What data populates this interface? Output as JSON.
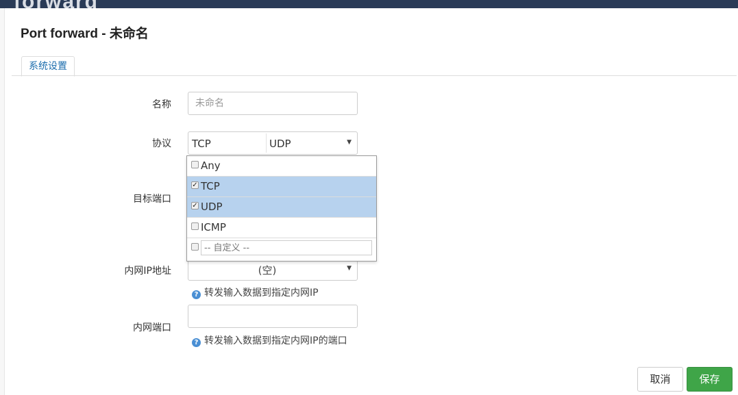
{
  "background": {
    "peek_text": "forward"
  },
  "dialog": {
    "title": "Port forward - 未命名",
    "tabs": [
      {
        "label": "系统设置",
        "active": true
      }
    ]
  },
  "form": {
    "name": {
      "label": "名称",
      "value": "",
      "placeholder": "未命名"
    },
    "protocol": {
      "label": "协议",
      "selected_values": [
        "TCP",
        "UDP"
      ],
      "options": [
        {
          "label": "Any",
          "checked": false
        },
        {
          "label": "TCP",
          "checked": true
        },
        {
          "label": "UDP",
          "checked": true
        },
        {
          "label": "ICMP",
          "checked": false
        }
      ],
      "custom_placeholder": "-- 自定义 --"
    },
    "target_port": {
      "label": "目标端口"
    },
    "lan_ip": {
      "label": "内网IP地址",
      "value": "(空)",
      "help": "转发输入数据到指定内网IP"
    },
    "lan_port": {
      "label": "内网端口",
      "value": "",
      "help": "转发输入数据到指定内网IP的端口"
    }
  },
  "buttons": {
    "cancel": "取消",
    "save": "保存"
  },
  "colors": {
    "accent": "#1c6dad",
    "save": "#3fa548",
    "selected_row": "#b7d2ee"
  }
}
